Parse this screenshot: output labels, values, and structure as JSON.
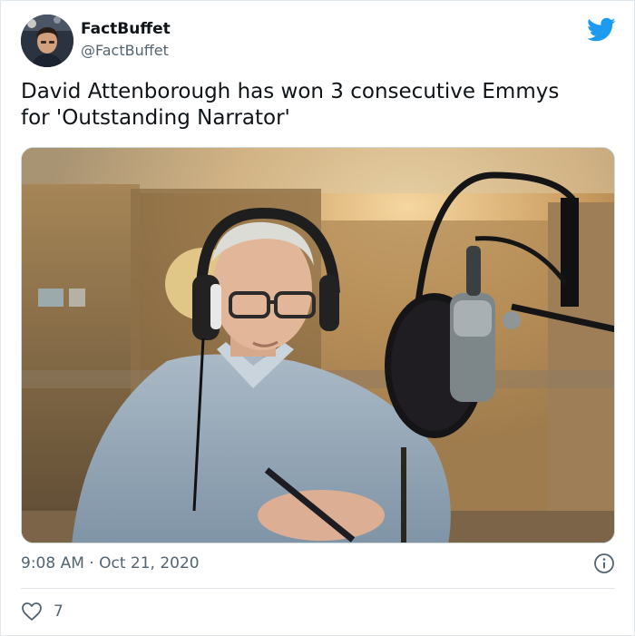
{
  "user": {
    "name": "FactBuffet",
    "handle": "@FactBuffet"
  },
  "tweet": {
    "text": "David Attenborough has won 3 consecutive Emmys\nfor 'Outstanding Narrator'",
    "timestamp": "9:08 AM · Oct 21, 2020",
    "likes": "7"
  },
  "icons": {
    "brand": "twitter-bird-icon",
    "info": "info-icon",
    "like": "heart-icon"
  },
  "colors": {
    "brand": "#1d9bf0",
    "muted": "#536471",
    "text": "#0f1419"
  }
}
